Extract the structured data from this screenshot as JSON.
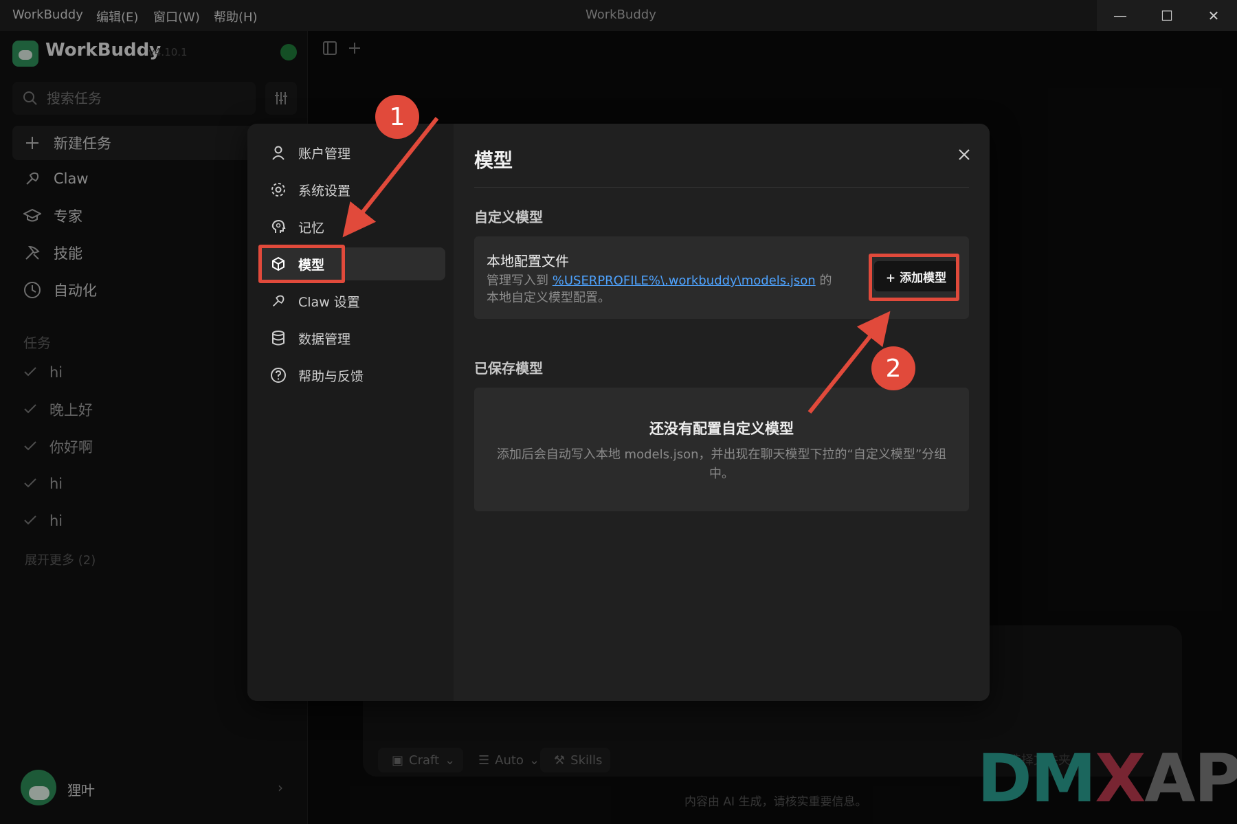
{
  "window": {
    "title": "WorkBuddy",
    "menu": [
      "WorkBuddy",
      "编辑(E)",
      "窗口(W)",
      "帮助(H)"
    ]
  },
  "sidebar": {
    "app_name": "WorkBuddy",
    "version": "v4.10.1",
    "search_placeholder": "搜索任务",
    "nav": [
      {
        "label": "新建任务",
        "icon": "plus-icon"
      },
      {
        "label": "Claw",
        "icon": "claw-icon"
      },
      {
        "label": "专家",
        "icon": "graduation-cap-icon"
      },
      {
        "label": "技能",
        "icon": "tools-icon"
      },
      {
        "label": "自动化",
        "icon": "clock-icon"
      }
    ],
    "tasks_label": "任务",
    "tasks": [
      "hi",
      "晚上好",
      "你好啊",
      "hi",
      "hi"
    ],
    "expand_more": "展开更多 (2)",
    "user_name": "狸叶"
  },
  "composer": {
    "mode_label": "Craft",
    "model_label": "Auto",
    "skills_label": "Skills",
    "folder_label": "选择文件夹",
    "disclaimer": "内容由 AI 生成，请核实重要信息。"
  },
  "settings": {
    "nav": [
      {
        "label": "账户管理",
        "icon": "user-icon"
      },
      {
        "label": "系统设置",
        "icon": "gear-icon"
      },
      {
        "label": "记忆",
        "icon": "brain-icon"
      },
      {
        "label": "模型",
        "icon": "cube-icon",
        "active": true
      },
      {
        "label": "Claw 设置",
        "icon": "claw-icon"
      },
      {
        "label": "数据管理",
        "icon": "database-icon"
      },
      {
        "label": "帮助与反馈",
        "icon": "help-icon"
      }
    ],
    "title": "模型",
    "custom_section": "自定义模型",
    "card": {
      "title": "本地配置文件",
      "desc_prefix": "管理写入到 ",
      "desc_link": "%USERPROFILE%\\.workbuddy\\models.json",
      "desc_suffix": " 的本地自定义模型配置。",
      "add_button": "+ 添加模型"
    },
    "saved_section": "已保存模型",
    "empty_title": "还没有配置自定义模型",
    "empty_desc": "添加后会自动写入本地 models.json，并出现在聊天模型下拉的“自定义模型”分组中。"
  },
  "annotations": {
    "badge_1": "1",
    "badge_2": "2",
    "color": "#e14a3b"
  },
  "watermark": {
    "part_a": "DM",
    "part_b": "X",
    "part_c": "API"
  }
}
